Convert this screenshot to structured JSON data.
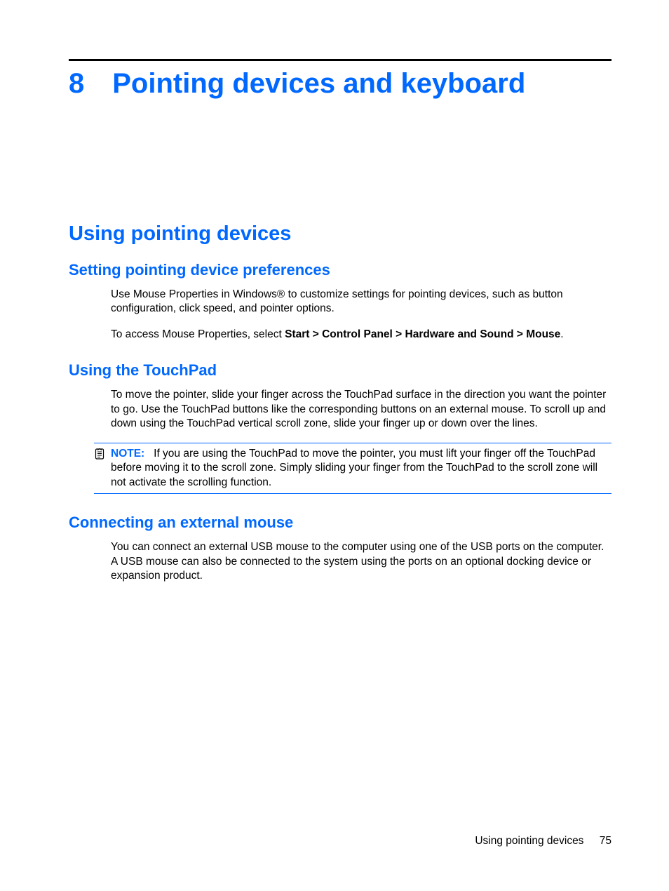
{
  "chapter": {
    "number": "8",
    "title": "Pointing devices and keyboard"
  },
  "section1": {
    "title": "Using pointing devices"
  },
  "subsection1": {
    "title": "Setting pointing device preferences",
    "p1": "Use Mouse Properties in Windows® to customize settings for pointing devices, such as button configuration, click speed, and pointer options.",
    "p2_prefix": "To access Mouse Properties, select ",
    "p2_bold": "Start > Control Panel > Hardware and Sound > Mouse",
    "p2_suffix": "."
  },
  "subsection2": {
    "title": "Using the TouchPad",
    "p1": "To move the pointer, slide your finger across the TouchPad surface in the direction you want the pointer to go. Use the TouchPad buttons like the corresponding buttons on an external mouse. To scroll up and down using the TouchPad vertical scroll zone, slide your finger up or down over the lines.",
    "note_label": "NOTE:",
    "note_body": "If you are using the TouchPad to move the pointer, you must lift your finger off the TouchPad before moving it to the scroll zone. Simply sliding your finger from the TouchPad to the scroll zone will not activate the scrolling function."
  },
  "subsection3": {
    "title": "Connecting an external mouse",
    "p1": "You can connect an external USB mouse to the computer using one of the USB ports on the computer. A USB mouse can also be connected to the system using the ports on an optional docking device or expansion product."
  },
  "footer": {
    "section": "Using pointing devices",
    "page": "75"
  },
  "colors": {
    "accent": "#0068ff"
  }
}
